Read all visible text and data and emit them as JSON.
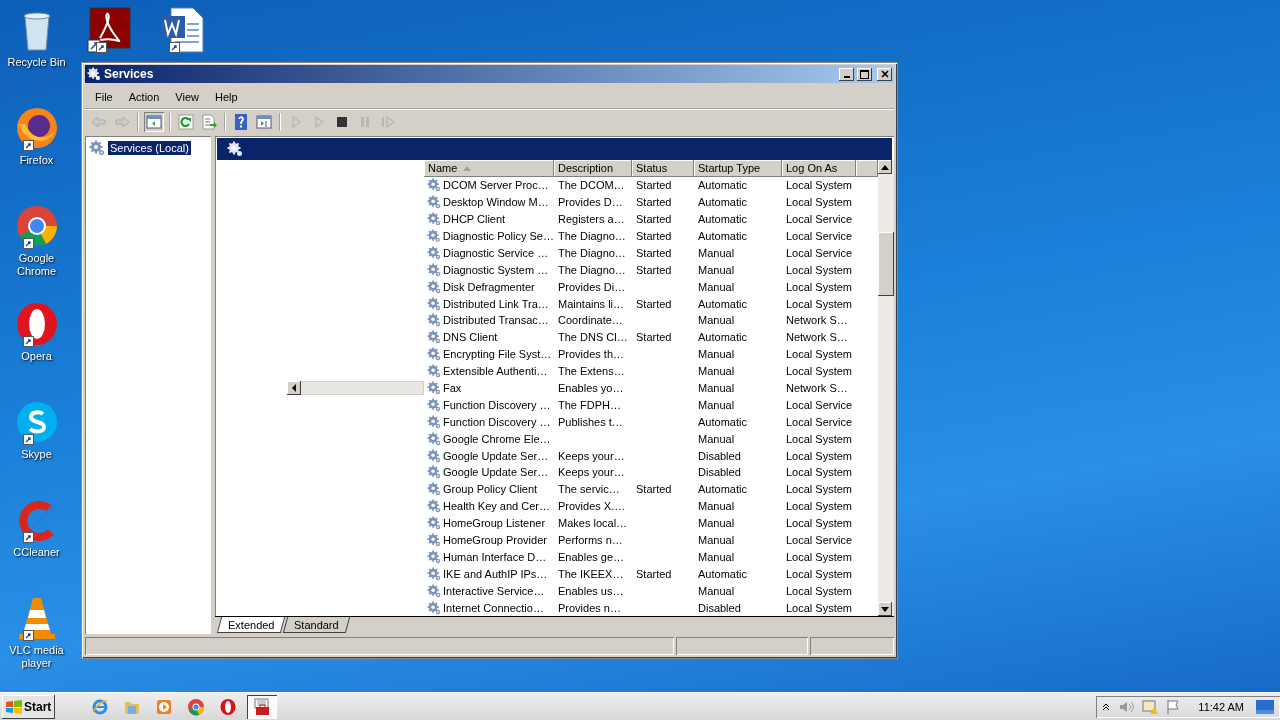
{
  "desktop": {
    "icons": [
      {
        "kind": "recycle",
        "label": "Recycle Bin"
      },
      {
        "kind": "pdf"
      },
      {
        "kind": "word"
      },
      {
        "kind": "firefox",
        "label": "Firefox"
      },
      {
        "kind": "chrome",
        "label": "Google Chrome"
      },
      {
        "kind": "opera",
        "label": "Opera"
      },
      {
        "kind": "skype",
        "label": "Skype"
      },
      {
        "kind": "ccleaner",
        "label": "CCleaner"
      },
      {
        "kind": "vlc",
        "label": "VLC media player"
      }
    ]
  },
  "window": {
    "title": "Services",
    "menu": [
      "File",
      "Action",
      "View",
      "Help"
    ],
    "toolbar": [
      {
        "kind": "back",
        "disabled": true
      },
      {
        "kind": "forward",
        "disabled": true
      },
      {
        "kind": "tree",
        "disabled": false
      },
      {
        "kind": "refresh",
        "disabled": false
      },
      {
        "kind": "export",
        "disabled": false
      },
      {
        "kind": "help",
        "disabled": false
      },
      {
        "kind": "pane",
        "disabled": false
      },
      {
        "kind": "play",
        "disabled": true
      },
      {
        "kind": "play",
        "disabled": true
      },
      {
        "kind": "stop",
        "disabled": false
      },
      {
        "kind": "pause",
        "disabled": true
      },
      {
        "kind": "restart",
        "disabled": true
      }
    ],
    "tree": [
      {
        "label": "Services (Local)",
        "selected": true
      }
    ],
    "table": {
      "columns": [
        {
          "label": "Name",
          "sorted": true
        },
        {
          "label": "Description",
          "sorted": false
        },
        {
          "label": "Status",
          "sorted": false
        },
        {
          "label": "Startup Type",
          "sorted": false
        },
        {
          "label": "Log On As",
          "sorted": false
        }
      ],
      "rows": [
        {
          "name": "DCOM Server Proc…",
          "description": "The DCOM…",
          "status": "Started",
          "startup_type": "Automatic",
          "log_on_as": "Local System"
        },
        {
          "name": "Desktop Window M…",
          "description": "Provides D…",
          "status": "Started",
          "startup_type": "Automatic",
          "log_on_as": "Local System"
        },
        {
          "name": "DHCP Client",
          "description": "Registers a…",
          "status": "Started",
          "startup_type": "Automatic",
          "log_on_as": "Local Service"
        },
        {
          "name": "Diagnostic Policy Se…",
          "description": "The Diagno…",
          "status": "Started",
          "startup_type": "Automatic",
          "log_on_as": "Local Service"
        },
        {
          "name": "Diagnostic Service …",
          "description": "The Diagno…",
          "status": "Started",
          "startup_type": "Manual",
          "log_on_as": "Local Service"
        },
        {
          "name": "Diagnostic System …",
          "description": "The Diagno…",
          "status": "Started",
          "startup_type": "Manual",
          "log_on_as": "Local System"
        },
        {
          "name": "Disk Defragmenter",
          "description": "Provides Di…",
          "startup_type": "Manual",
          "log_on_as": "Local System"
        },
        {
          "name": "Distributed Link Tra…",
          "description": "Maintains li…",
          "status": "Started",
          "startup_type": "Automatic",
          "log_on_as": "Local System"
        },
        {
          "name": "Distributed Transac…",
          "description": "Coordinate…",
          "startup_type": "Manual",
          "log_on_as": "Network S…"
        },
        {
          "name": "DNS Client",
          "description": "The DNS Cl…",
          "status": "Started",
          "startup_type": "Automatic",
          "log_on_as": "Network S…"
        },
        {
          "name": "Encrypting File Syst…",
          "description": "Provides th…",
          "startup_type": "Manual",
          "log_on_as": "Local System"
        },
        {
          "name": "Extensible Authenti…",
          "description": "The Extens…",
          "startup_type": "Manual",
          "log_on_as": "Local System"
        },
        {
          "name": "Fax",
          "description": "Enables yo…",
          "startup_type": "Manual",
          "log_on_as": "Network S…"
        },
        {
          "name": "Function Discovery …",
          "description": "The FDPH…",
          "startup_type": "Manual",
          "log_on_as": "Local Service"
        },
        {
          "name": "Function Discovery …",
          "description": "Publishes t…",
          "startup_type": "Automatic",
          "log_on_as": "Local Service"
        },
        {
          "name": "Google Chrome Ele…",
          "startup_type": "Manual",
          "log_on_as": "Local System"
        },
        {
          "name": "Google Update Ser…",
          "description": "Keeps your…",
          "startup_type": "Disabled",
          "log_on_as": "Local System"
        },
        {
          "name": "Google Update Ser…",
          "description": "Keeps your…",
          "startup_type": "Disabled",
          "log_on_as": "Local System"
        },
        {
          "name": "Group Policy Client",
          "description": "The servic…",
          "status": "Started",
          "startup_type": "Automatic",
          "log_on_as": "Local System"
        },
        {
          "name": "Health Key and Cer…",
          "description": "Provides X.…",
          "startup_type": "Manual",
          "log_on_as": "Local System"
        },
        {
          "name": "HomeGroup Listener",
          "description": "Makes local…",
          "startup_type": "Manual",
          "log_on_as": "Local System"
        },
        {
          "name": "HomeGroup Provider",
          "description": "Performs n…",
          "startup_type": "Manual",
          "log_on_as": "Local Service"
        },
        {
          "name": "Human Interface D…",
          "description": "Enables ge…",
          "startup_type": "Manual",
          "log_on_as": "Local System"
        },
        {
          "name": "IKE and AuthIP IPs…",
          "description": "The IKEEX…",
          "status": "Started",
          "startup_type": "Automatic",
          "log_on_as": "Local System"
        },
        {
          "name": "Interactive Service…",
          "description": "Enables us…",
          "startup_type": "Manual",
          "log_on_as": "Local System"
        },
        {
          "name": "Internet Connectio…",
          "description": "Provides n…",
          "startup_type": "Disabled",
          "log_on_as": "Local System"
        }
      ]
    },
    "tabs": [
      {
        "label": "Extended",
        "selected": true
      },
      {
        "label": "Standard",
        "selected": false
      }
    ]
  },
  "taskbar": {
    "start": "Start",
    "apps": [
      {
        "kind": "ie",
        "active": false
      },
      {
        "kind": "explorer",
        "active": false
      },
      {
        "kind": "media",
        "active": false
      },
      {
        "kind": "chrome",
        "active": false
      },
      {
        "kind": "opera",
        "active": false
      },
      {
        "kind": "services",
        "active": true
      }
    ],
    "tray": {
      "time": "11:42 AM"
    }
  }
}
